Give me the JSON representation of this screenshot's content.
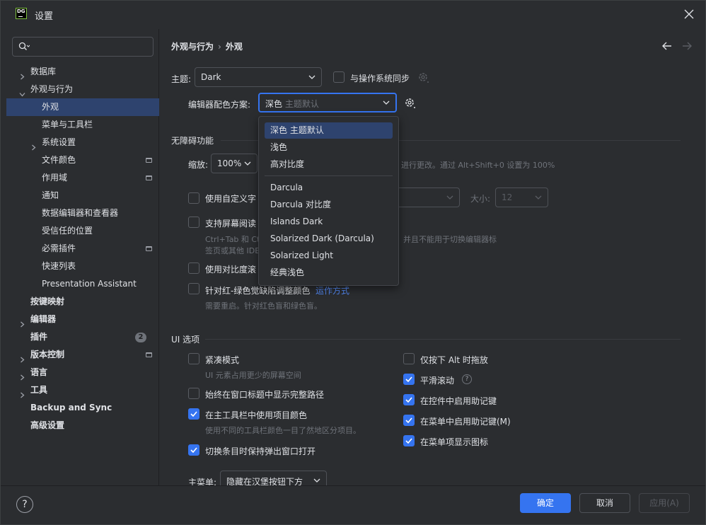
{
  "window": {
    "title": "设置",
    "logo_text": "DG"
  },
  "search": {
    "placeholder": "",
    "value": ""
  },
  "sidebar": {
    "items": [
      {
        "label": "数据库",
        "level": 0,
        "expandable": true,
        "expanded": false,
        "bold": false
      },
      {
        "label": "外观与行为",
        "level": 0,
        "expandable": true,
        "expanded": true,
        "bold": false
      },
      {
        "label": "外观",
        "level": 1,
        "selected": true
      },
      {
        "label": "菜单与工具栏",
        "level": 1
      },
      {
        "label": "系统设置",
        "level": 1,
        "expandable": true,
        "expanded": false
      },
      {
        "label": "文件颜色",
        "level": 1,
        "pinned": true
      },
      {
        "label": "作用域",
        "level": 1,
        "pinned": true
      },
      {
        "label": "通知",
        "level": 1
      },
      {
        "label": "数据编辑器和查看器",
        "level": 1
      },
      {
        "label": "受信任的位置",
        "level": 1
      },
      {
        "label": "必需插件",
        "level": 1,
        "pinned": true
      },
      {
        "label": "快速列表",
        "level": 1
      },
      {
        "label": "Presentation Assistant",
        "level": 1
      },
      {
        "label": "按键映射",
        "level": 0,
        "bold": true
      },
      {
        "label": "编辑器",
        "level": 0,
        "expandable": true,
        "bold": true
      },
      {
        "label": "插件",
        "level": 0,
        "bold": true,
        "badge": "2"
      },
      {
        "label": "版本控制",
        "level": 0,
        "expandable": true,
        "bold": true,
        "pinned": true
      },
      {
        "label": "语言",
        "level": 0,
        "expandable": true,
        "bold": true
      },
      {
        "label": "工具",
        "level": 0,
        "expandable": true,
        "bold": true
      },
      {
        "label": "Backup and Sync",
        "level": 0,
        "bold": true
      },
      {
        "label": "高级设置",
        "level": 0,
        "bold": true
      }
    ]
  },
  "breadcrumb": {
    "parent": "外观与行为",
    "separator": "›",
    "current": "外观"
  },
  "theme": {
    "label": "主题:",
    "value": "Dark",
    "sync_label": "与操作系统同步",
    "sync_checked": false
  },
  "scheme": {
    "label": "编辑器配色方案:",
    "value_main": "深色",
    "value_hint": "主题默认",
    "options": [
      {
        "label": "深色 主题默认",
        "selected": true
      },
      {
        "label": "浅色"
      },
      {
        "label": "高对比度"
      },
      {
        "label": "Darcula"
      },
      {
        "label": "Darcula 对比度"
      },
      {
        "label": "Islands Dark"
      },
      {
        "label": "Solarized Dark (Darcula)"
      },
      {
        "label": "Solarized Light"
      },
      {
        "label": "经典浅色"
      }
    ]
  },
  "accessibility": {
    "title": "无障碍功能",
    "zoom_label": "缩放:",
    "zoom_value": "100%",
    "zoom_hint": "进行更改。通过 Alt+Shift+0 设置为 100%",
    "custom_font_label": "使用自定义字",
    "size_label": "大小:",
    "size_value": "12",
    "screen_reader_label": "支持屏幕阅读",
    "screen_reader_hint_1a": "Ctrl+Tab 和 Ct",
    "screen_reader_hint_1b": "并且不能用于切换编辑器标",
    "screen_reader_hint_2": "签页或其他 IDE",
    "contrast_scroll_label": "使用对比度滚",
    "color_blind_label": "针对红-绿色觉缺陷调整颜色",
    "color_blind_link": "运作方式",
    "color_blind_hint": "需要重启。针对红色盲和绿色盲。"
  },
  "ui_options": {
    "title": "UI 选项",
    "left": [
      {
        "label": "紧凑模式",
        "checked": false,
        "hint": "UI 元素占用更少的屏幕空间"
      },
      {
        "label": "始终在窗口标题中显示完整路径",
        "checked": false
      },
      {
        "label": "在主工具栏中使用项目颜色",
        "checked": true,
        "hint": "使用不同的工具栏颜色一目了然地区分项目。"
      },
      {
        "label": "切换条目时保持弹出窗口打开",
        "checked": true
      }
    ],
    "right": [
      {
        "label": "仅按下 Alt 时拖放",
        "checked": false
      },
      {
        "label": "平滑滚动",
        "checked": true,
        "help": "?"
      },
      {
        "label": "在控件中启用助记键",
        "checked": true
      },
      {
        "label": "在菜单中启用助记键(M)",
        "checked": true
      },
      {
        "label": "在菜单项显示图标",
        "checked": true
      }
    ],
    "main_menu_label": "主菜单:",
    "main_menu_value": "隐藏在汉堡按钮下方"
  },
  "footer": {
    "help": "?",
    "ok": "确定",
    "cancel": "取消",
    "apply": "应用(A)"
  },
  "colors": {
    "accent": "#3574f0",
    "selection": "#2e436e",
    "background": "#2b2d30",
    "link": "#548af7"
  }
}
